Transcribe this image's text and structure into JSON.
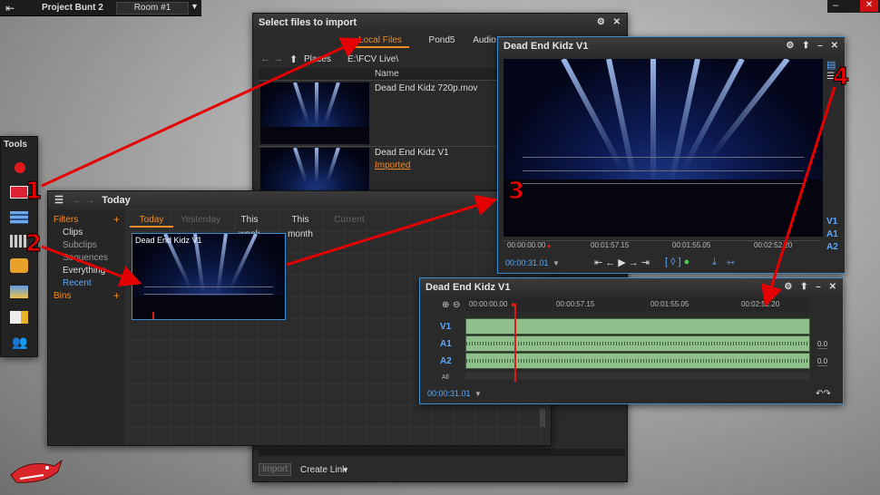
{
  "topbar": {
    "project": "Project Bunt 2",
    "room": "Room #1"
  },
  "tools": {
    "title": "Tools"
  },
  "import": {
    "title": "Select files to import",
    "tabs": [
      "Local Files",
      "Pond5",
      "Audio"
    ],
    "places_label": "Places",
    "path": "E:\\FCV Live\\",
    "column_name": "Name",
    "files": [
      {
        "name": "Dead End Kidz 720p.mov",
        "status": ""
      },
      {
        "name": "Dead End Kidz V1",
        "status": "Imported"
      }
    ],
    "import_btn": "Import",
    "create_link": "Create Link"
  },
  "browser": {
    "title": "Today",
    "filters_label": "Filters",
    "filters": [
      "Clips",
      "Subclips",
      "Sequences",
      "Everything",
      "Recent"
    ],
    "bins_label": "Bins",
    "date_tabs": [
      "Today",
      "Yesterday",
      "This week",
      "This month",
      "Current"
    ],
    "clip_label": "Dead End Kidz V1"
  },
  "viewer": {
    "title": "Dead End Kidz V1",
    "ruler": [
      "00:00:00.00",
      "00:01:57.15",
      "00:01:55.05",
      "00:02:52.20"
    ],
    "tc": "00:00:31.01",
    "tracks": [
      "V1",
      "A1",
      "A2"
    ]
  },
  "timeline": {
    "title": "Dead End Kidz V1",
    "ruler": [
      "00:00:00.00",
      "00:00:57.15",
      "00:01:55.05",
      "00:02:52.20"
    ],
    "tracks": [
      "V1",
      "A1",
      "A2",
      "All"
    ],
    "levels": [
      "0.0",
      "0.0"
    ],
    "tc": "00:00:31.01"
  },
  "callouts": [
    "1",
    "2",
    "3",
    "4"
  ],
  "colors": {
    "accent": "#f08a24",
    "active_border": "#3a8fd6",
    "arrow": "#e40000",
    "audio": "#8fbf8a"
  }
}
